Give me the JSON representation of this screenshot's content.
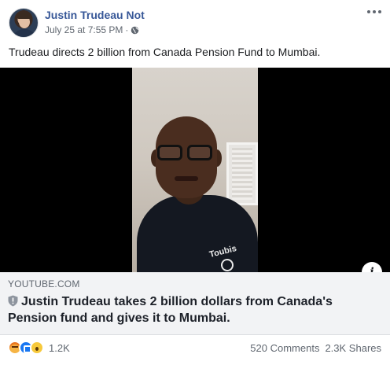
{
  "post": {
    "page_name": "Justin Trudeau Not",
    "timestamp": "July 25 at 7:55 PM",
    "separator": "·",
    "privacy_icon": "globe-icon",
    "text": "Trudeau directs 2 billion from Canada Pension Fund to Mumbai."
  },
  "video": {
    "shirt_text": "Toubis",
    "info_icon_label": "i"
  },
  "link_preview": {
    "domain": "YOUTUBE.COM",
    "headline": "Justin Trudeau takes 2 billion dollars from Canada's Pension fund and gives it to Mumbai."
  },
  "footer": {
    "reactions": [
      "angry-reaction-icon",
      "like-reaction-icon",
      "wow-reaction-icon"
    ],
    "reaction_count": "1.2K",
    "comments": "520 Comments",
    "shares": "2.3K Shares"
  },
  "colors": {
    "page_name": "#385898",
    "meta_text": "#606770",
    "link_box_bg": "#f2f3f5",
    "like_blue": "#1877f2"
  }
}
